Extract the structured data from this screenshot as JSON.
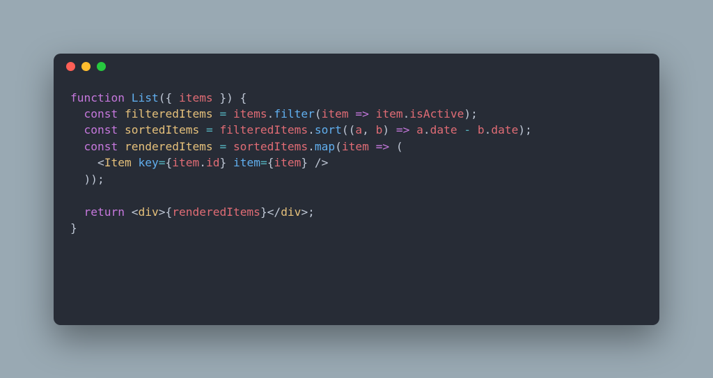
{
  "colors": {
    "background_page": "#99a9b3",
    "background_editor": "#272c36",
    "traffic_close": "#ff5f56",
    "traffic_min": "#ffbd2e",
    "traffic_max": "#27c93f",
    "tok_keyword": "#c678dd",
    "tok_function": "#61afef",
    "tok_param": "#e06c75",
    "tok_ident": "#e5c07b",
    "tok_punc": "#bfc7d5",
    "tok_operator": "#56b6c2"
  },
  "code": {
    "lines": [
      [
        {
          "c": "kw",
          "t": "function"
        },
        {
          "c": "punc",
          "t": " "
        },
        {
          "c": "fn",
          "t": "List"
        },
        {
          "c": "punc",
          "t": "({ "
        },
        {
          "c": "prm",
          "t": "items"
        },
        {
          "c": "punc",
          "t": " }) {"
        }
      ],
      [
        {
          "c": "punc",
          "t": "  "
        },
        {
          "c": "kw",
          "t": "const"
        },
        {
          "c": "punc",
          "t": " "
        },
        {
          "c": "ident",
          "t": "filteredItems"
        },
        {
          "c": "punc",
          "t": " "
        },
        {
          "c": "op",
          "t": "="
        },
        {
          "c": "punc",
          "t": " "
        },
        {
          "c": "prm",
          "t": "items"
        },
        {
          "c": "punc",
          "t": "."
        },
        {
          "c": "fn",
          "t": "filter"
        },
        {
          "c": "punc",
          "t": "("
        },
        {
          "c": "prm",
          "t": "item"
        },
        {
          "c": "punc",
          "t": " "
        },
        {
          "c": "kw",
          "t": "=>"
        },
        {
          "c": "punc",
          "t": " "
        },
        {
          "c": "prm",
          "t": "item"
        },
        {
          "c": "punc",
          "t": "."
        },
        {
          "c": "prm",
          "t": "isActive"
        },
        {
          "c": "punc",
          "t": ");"
        }
      ],
      [
        {
          "c": "punc",
          "t": "  "
        },
        {
          "c": "kw",
          "t": "const"
        },
        {
          "c": "punc",
          "t": " "
        },
        {
          "c": "ident",
          "t": "sortedItems"
        },
        {
          "c": "punc",
          "t": " "
        },
        {
          "c": "op",
          "t": "="
        },
        {
          "c": "punc",
          "t": " "
        },
        {
          "c": "prm",
          "t": "filteredItems"
        },
        {
          "c": "punc",
          "t": "."
        },
        {
          "c": "fn",
          "t": "sort"
        },
        {
          "c": "punc",
          "t": "(("
        },
        {
          "c": "prm",
          "t": "a"
        },
        {
          "c": "punc",
          "t": ", "
        },
        {
          "c": "prm",
          "t": "b"
        },
        {
          "c": "punc",
          "t": ") "
        },
        {
          "c": "kw",
          "t": "=>"
        },
        {
          "c": "punc",
          "t": " "
        },
        {
          "c": "prm",
          "t": "a"
        },
        {
          "c": "punc",
          "t": "."
        },
        {
          "c": "prm",
          "t": "date"
        },
        {
          "c": "punc",
          "t": " "
        },
        {
          "c": "op",
          "t": "-"
        },
        {
          "c": "punc",
          "t": " "
        },
        {
          "c": "prm",
          "t": "b"
        },
        {
          "c": "punc",
          "t": "."
        },
        {
          "c": "prm",
          "t": "date"
        },
        {
          "c": "punc",
          "t": ");"
        }
      ],
      [
        {
          "c": "punc",
          "t": "  "
        },
        {
          "c": "kw",
          "t": "const"
        },
        {
          "c": "punc",
          "t": " "
        },
        {
          "c": "ident",
          "t": "renderedItems"
        },
        {
          "c": "punc",
          "t": " "
        },
        {
          "c": "op",
          "t": "="
        },
        {
          "c": "punc",
          "t": " "
        },
        {
          "c": "prm",
          "t": "sortedItems"
        },
        {
          "c": "punc",
          "t": "."
        },
        {
          "c": "fn",
          "t": "map"
        },
        {
          "c": "punc",
          "t": "("
        },
        {
          "c": "prm",
          "t": "item"
        },
        {
          "c": "punc",
          "t": " "
        },
        {
          "c": "kw",
          "t": "=>"
        },
        {
          "c": "punc",
          "t": " ("
        }
      ],
      [
        {
          "c": "punc",
          "t": "    <"
        },
        {
          "c": "ident",
          "t": "Item"
        },
        {
          "c": "punc",
          "t": " "
        },
        {
          "c": "fn",
          "t": "key"
        },
        {
          "c": "op",
          "t": "="
        },
        {
          "c": "punc",
          "t": "{"
        },
        {
          "c": "prm",
          "t": "item"
        },
        {
          "c": "punc",
          "t": "."
        },
        {
          "c": "prm",
          "t": "id"
        },
        {
          "c": "punc",
          "t": "} "
        },
        {
          "c": "fn",
          "t": "item"
        },
        {
          "c": "op",
          "t": "="
        },
        {
          "c": "punc",
          "t": "{"
        },
        {
          "c": "prm",
          "t": "item"
        },
        {
          "c": "punc",
          "t": "} />"
        }
      ],
      [
        {
          "c": "punc",
          "t": "  ));"
        }
      ],
      [
        {
          "c": "punc",
          "t": ""
        }
      ],
      [
        {
          "c": "punc",
          "t": "  "
        },
        {
          "c": "kw",
          "t": "return"
        },
        {
          "c": "punc",
          "t": " <"
        },
        {
          "c": "ident",
          "t": "div"
        },
        {
          "c": "punc",
          "t": ">{"
        },
        {
          "c": "prm",
          "t": "renderedItems"
        },
        {
          "c": "punc",
          "t": "}</"
        },
        {
          "c": "ident",
          "t": "div"
        },
        {
          "c": "punc",
          "t": ">;"
        }
      ],
      [
        {
          "c": "punc",
          "t": "}"
        }
      ]
    ]
  }
}
